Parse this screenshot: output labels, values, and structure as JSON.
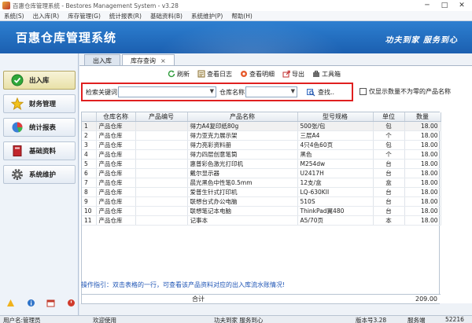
{
  "window": {
    "title": "百惠仓库管理系统 - Bestores Management System - v3.28",
    "controls": [
      "─",
      "□",
      "✕"
    ]
  },
  "menu": [
    "系统(S)",
    "出入库(R)",
    "库存管理(G)",
    "统计报表(R)",
    "基础资料(B)",
    "系统维护(P)",
    "帮助(H)"
  ],
  "banner": {
    "system_name": "百惠仓库管理系统",
    "slogan": "功夫到家 服务到心"
  },
  "nav": [
    {
      "label": "出入库",
      "icon": "check-circle-icon",
      "active": true
    },
    {
      "label": "财务管理",
      "icon": "star-icon",
      "active": false
    },
    {
      "label": "统计报表",
      "icon": "pie-chart-icon",
      "active": false
    },
    {
      "label": "基础资料",
      "icon": "book-icon",
      "active": false
    },
    {
      "label": "系统维护",
      "icon": "gear-icon",
      "active": false
    }
  ],
  "tabs": [
    {
      "label": "出入库",
      "active": false
    },
    {
      "label": "库存查询",
      "active": true,
      "closable": true
    }
  ],
  "toolbar": {
    "refresh": "刷新",
    "view_log": "查看日志",
    "view_detail": "查看明细",
    "export": "导出",
    "toolbox": "工具箱"
  },
  "search": {
    "keyword_label": "检索关键词",
    "keyword_value": "",
    "warehouse_label": "仓库名称",
    "warehouse_value": "",
    "search_button": "查找..",
    "filter_label": "仅显示数量不为零的产品名称"
  },
  "table": {
    "columns": [
      "",
      "仓库名称",
      "产品编号",
      "产品名称",
      "型号规格",
      "单位",
      "数量"
    ],
    "rows": [
      [
        "1",
        "产品仓库",
        "",
        "得力A4复印纸80g",
        "500张/包",
        "包",
        "18.00"
      ],
      [
        "2",
        "产品仓库",
        "",
        "得力亚克力展示架",
        "三层A4",
        "个",
        "18.00"
      ],
      [
        "3",
        "产品仓库",
        "",
        "得力亮彩资料册",
        "4只4色60页",
        "包",
        "18.00"
      ],
      [
        "4",
        "产品仓库",
        "",
        "得力四层创意笔筒",
        "黑色",
        "个",
        "18.00"
      ],
      [
        "5",
        "产品仓库",
        "",
        "惠普彩色激光打印机",
        "M254dw",
        "台",
        "18.00"
      ],
      [
        "6",
        "产品仓库",
        "",
        "戴尔显示器",
        "U2417H",
        "台",
        "18.00"
      ],
      [
        "7",
        "产品仓库",
        "",
        "晨光黑色中性笔0.5mm",
        "12支/盒",
        "盒",
        "18.00"
      ],
      [
        "8",
        "产品仓库",
        "",
        "爱普生针式打印机",
        "LQ-630KII",
        "台",
        "18.00"
      ],
      [
        "9",
        "产品仓库",
        "",
        "联想台式办公电脑",
        "510S",
        "台",
        "18.00"
      ],
      [
        "10",
        "产品仓库",
        "",
        "联想笔记本电脑",
        "ThinkPad翼480",
        "台",
        "18.00"
      ],
      [
        "11",
        "产品仓库",
        "",
        "记事本",
        "A5/70页",
        "本",
        "18.00"
      ]
    ],
    "total_label": "合计",
    "total_value": "209.00"
  },
  "tip": "操作指引：双击表格的一行，可查看该产品资料对应的出入库流水账情况!",
  "status": {
    "user": "用户名:管理员",
    "welcome": "欢迎使用",
    "slogan": "功夫到家 服务到心",
    "version": "版本号3.28",
    "port_label": "服务端",
    "port": "52216"
  },
  "colors": {
    "banner": "#1b5fb0",
    "highlight_border": "#e02020",
    "tip_text": "#1f55b5"
  }
}
